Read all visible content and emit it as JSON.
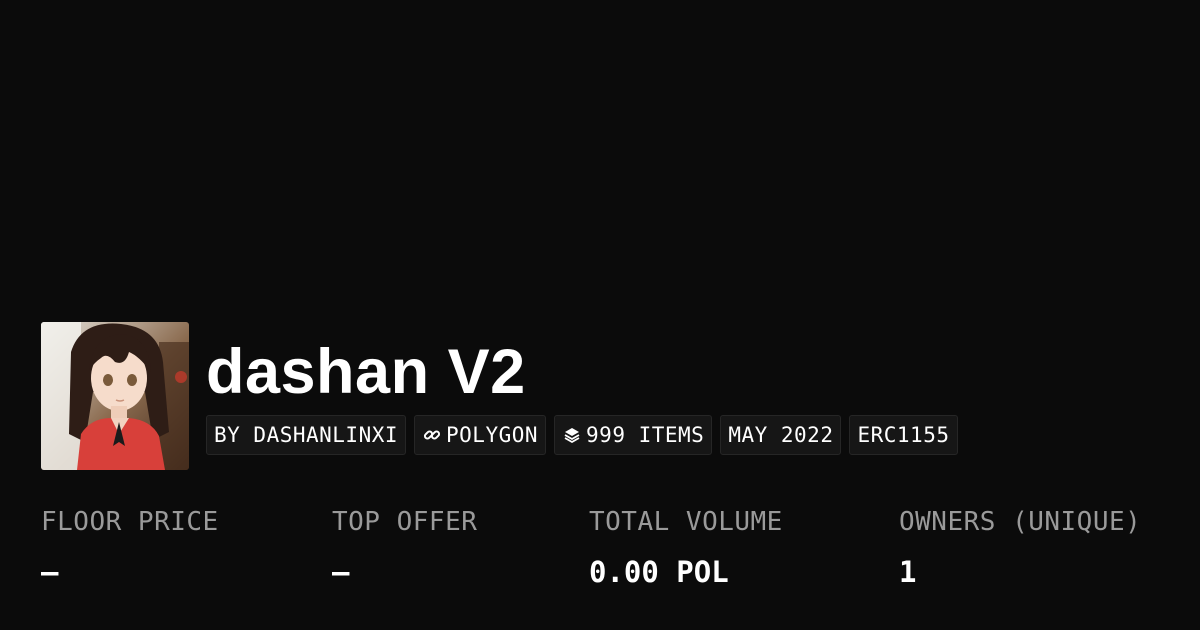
{
  "collection": {
    "title": "dashan V2",
    "avatar_icon": "anime-girl-avatar"
  },
  "chips": {
    "creator": "BY DASHANLINXI",
    "chain": "POLYGON",
    "chain_icon": "chain-link-icon",
    "items": "999 ITEMS",
    "items_icon": "layers-icon",
    "date": "MAY 2022",
    "standard": "ERC1155"
  },
  "stats": {
    "floor_price": {
      "label": "FLOOR PRICE",
      "value": "–"
    },
    "top_offer": {
      "label": "TOP OFFER",
      "value": "–"
    },
    "total_volume": {
      "label": "TOTAL VOLUME",
      "value": "0.00 POL"
    },
    "owners": {
      "label": "OWNERS (UNIQUE)",
      "value": "1"
    }
  },
  "colors": {
    "background": "#0b0b0b",
    "chip_background": "#161616",
    "label": "#9a9a9a",
    "text": "#ffffff"
  }
}
